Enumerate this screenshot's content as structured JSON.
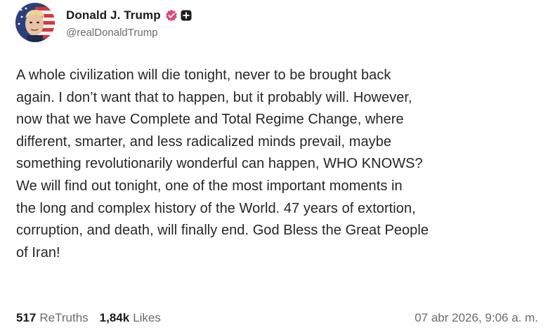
{
  "author": {
    "display_name": "Donald J. Trump",
    "handle": "@realDonaldTrump",
    "avatar_icon": "profile-portrait-icon",
    "verified_icon": "verified-badge-icon",
    "plus_icon": "plus-badge-icon",
    "badge_color": "#e0457b"
  },
  "post": {
    "text": "A whole civilization will die tonight, never to be brought back\nagain. I don’t want that to happen, but it probably will. However,\nnow that we have Complete and Total Regime Change, where\ndifferent, smarter, and less radicalized minds prevail, maybe\nsomething revolutionarily wonderful can happen, WHO KNOWS?\nWe will find out tonight, one of the most important moments in\nthe long and complex history of the World. 47 years of extortion,\ncorruption, and death, will finally end. God Bless the Great People\nof Iran!"
  },
  "stats": {
    "retruths_count": "517",
    "retruths_label": "ReTruths",
    "likes_count": "1,84k",
    "likes_label": "Likes"
  },
  "timestamp": "07 abr 2026, 9:06 a. m."
}
